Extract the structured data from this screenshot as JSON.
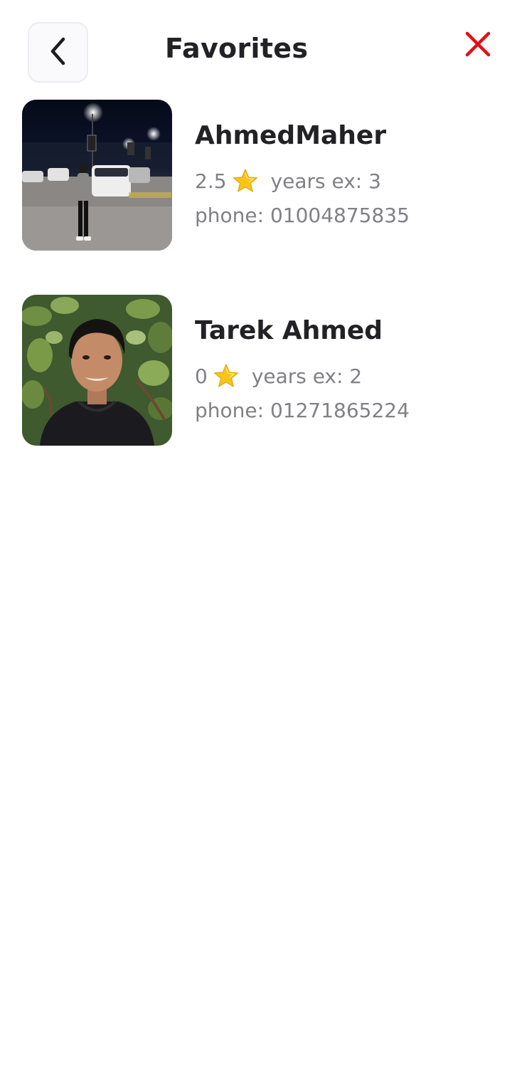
{
  "header": {
    "title": "Favorites",
    "back_icon": "chevron-left-icon",
    "close_icon": "close-icon",
    "close_color": "#e0101a"
  },
  "favorites": [
    {
      "name": "AhmedMaher",
      "rating": "2.5",
      "rating_icon": "star-icon",
      "years_ex": "years ex: 3",
      "phone": "phone: 01004875835"
    },
    {
      "name": "Tarek Ahmed",
      "rating": "0",
      "rating_icon": "star-icon",
      "years_ex": "years ex: 2",
      "phone": "phone: 01271865224"
    }
  ],
  "colors": {
    "title": "#222226",
    "secondary_text": "#808085",
    "star": "#f7c518"
  }
}
